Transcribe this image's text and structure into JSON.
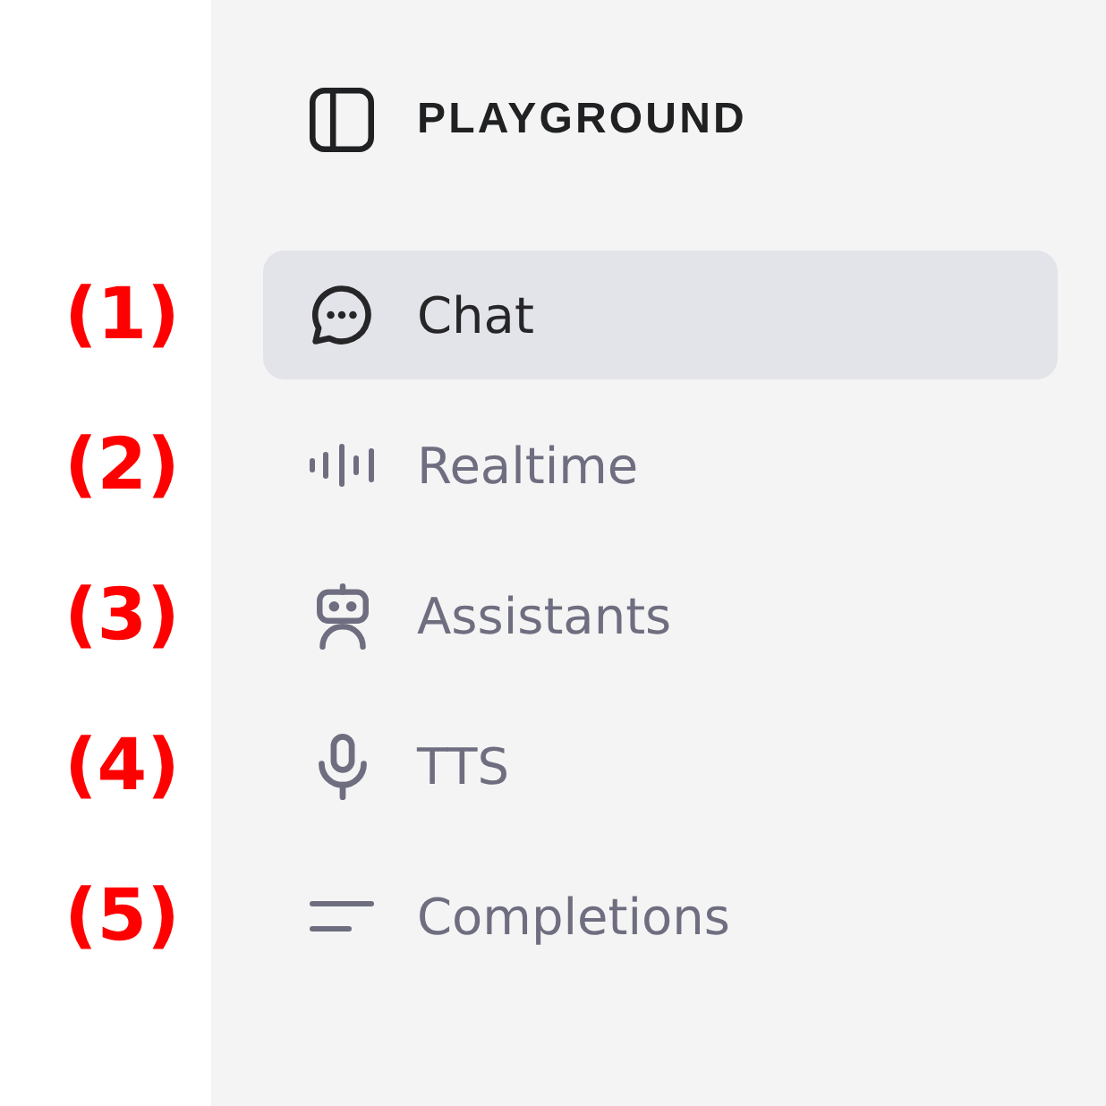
{
  "callouts": [
    "(1)",
    "(2)",
    "(3)",
    "(4)",
    "(5)"
  ],
  "sidebar": {
    "title": "PLAYGROUND",
    "items": [
      {
        "label": "Chat",
        "kind": "chat",
        "selected": true
      },
      {
        "label": "Realtime",
        "kind": "wave",
        "selected": false
      },
      {
        "label": "Assistants",
        "kind": "robot",
        "selected": false
      },
      {
        "label": "TTS",
        "kind": "mic",
        "selected": false
      },
      {
        "label": "Completions",
        "kind": "lines",
        "selected": false
      }
    ]
  }
}
